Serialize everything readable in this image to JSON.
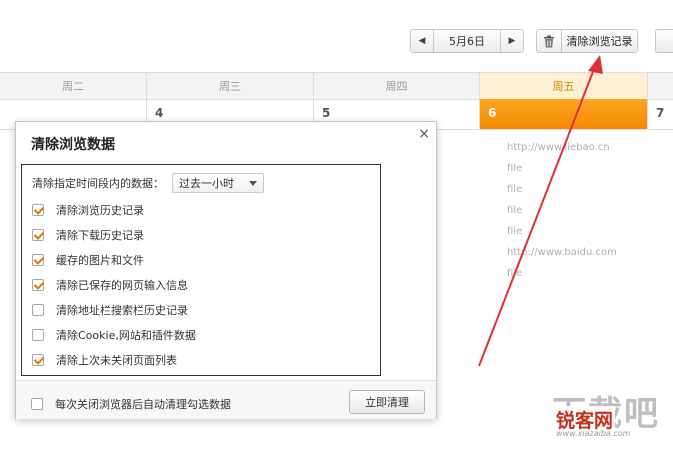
{
  "toolbar": {
    "date": "5月6日",
    "clear_history_label": "清除浏览记录"
  },
  "calendar": {
    "days": [
      {
        "label": "周二",
        "num": ""
      },
      {
        "label": "周三",
        "num": "4"
      },
      {
        "label": "周四",
        "num": "5"
      },
      {
        "label": "周五",
        "num": "6"
      },
      {
        "label": "",
        "num": "7"
      }
    ],
    "today_index": 3
  },
  "history": [
    "http://www.liebao.cn",
    "file",
    "file",
    "file",
    "file",
    "http://www.baidu.com",
    "file"
  ],
  "dialog": {
    "title": "清除浏览数据",
    "close": "×",
    "range_label": "清除指定时间段内的数据：",
    "range_value": "过去一小时",
    "options": [
      {
        "label": "清除浏览历史记录",
        "checked": true
      },
      {
        "label": "清除下载历史记录",
        "checked": true
      },
      {
        "label": "缓存的图片和文件",
        "checked": true
      },
      {
        "label": "清除已保存的网页输入信息",
        "checked": true
      },
      {
        "label": "清除地址栏搜索栏历史记录",
        "checked": false
      },
      {
        "label": "清除Cookie,网站和插件数据",
        "checked": false
      },
      {
        "label": "清除上次未关闭页面列表",
        "checked": true
      }
    ],
    "auto_clear_label": "每次关闭浏览器后自动清理勾选数据",
    "auto_clear_checked": false,
    "clear_now_label": "立即清理"
  },
  "watermark": {
    "big": "下载吧",
    "small": "锐客网",
    "url": "www.xiazaiba.com"
  },
  "colors": {
    "accent": "#f28900",
    "arrow": "#e0303a"
  }
}
